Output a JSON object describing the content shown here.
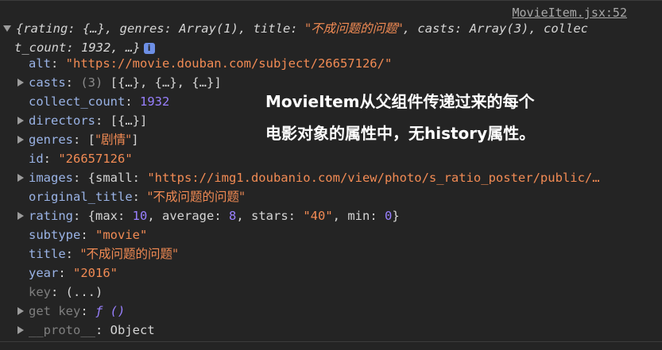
{
  "source_link": "MovieItem.jsx:52",
  "summary": {
    "line1_a": "{rating: {…}, genres: Array(1), title: ",
    "line1_title": "\"不成问题的问题\"",
    "line1_b": ", casts: Array(3), collec",
    "line2": "t_count: 1932, …}",
    "info_badge": "i"
  },
  "properties": [
    {
      "key": "alt",
      "sep": ": ",
      "value": "\"https://movie.douban.com/subject/26657126/\"",
      "value_type": "str",
      "expandable": false
    },
    {
      "key": "casts",
      "sep": ": ",
      "prefix": "(3) ",
      "value": "[{…}, {…}, {…}]",
      "value_type": "plain",
      "expandable": true
    },
    {
      "key": "collect_count",
      "sep": ": ",
      "value": "1932",
      "value_type": "num",
      "expandable": false
    },
    {
      "key": "directors",
      "sep": ": ",
      "value": "[{…}]",
      "value_type": "plain",
      "expandable": true
    },
    {
      "key": "genres",
      "sep": ": ",
      "value_open": "[",
      "value": "\"剧情\"",
      "value_close": "]",
      "value_type": "str",
      "expandable": true
    },
    {
      "key": "id",
      "sep": ": ",
      "value": "\"26657126\"",
      "value_type": "str",
      "expandable": false
    },
    {
      "key": "images",
      "sep": ": ",
      "value_open": "{small: ",
      "value": "\"https://img1.doubanio.com/view/photo/s_ratio_poster/public/…",
      "value_type": "str",
      "expandable": true
    },
    {
      "key": "original_title",
      "sep": ": ",
      "value": "\"不成问题的问题\"",
      "value_type": "str",
      "expandable": false
    },
    {
      "key": "rating",
      "sep": ": ",
      "expandable": true,
      "rating_parts": {
        "open": "{max: ",
        "max": "10",
        "sep1": ", average: ",
        "average": "8",
        "sep2": ", stars: ",
        "stars": "\"40\"",
        "sep3": ", min: ",
        "min": "0",
        "close": "}"
      }
    },
    {
      "key": "subtype",
      "sep": ": ",
      "value": "\"movie\"",
      "value_type": "str",
      "expandable": false
    },
    {
      "key": "title",
      "sep": ": ",
      "value": "\"不成问题的问题\"",
      "value_type": "str",
      "expandable": false
    },
    {
      "key": "year",
      "sep": ": ",
      "value": "\"2016\"",
      "value_type": "str",
      "expandable": false
    },
    {
      "key": "key",
      "sep": ": ",
      "value": "(...)",
      "value_type": "plain",
      "expandable": false,
      "dim_key": true
    },
    {
      "key": "get key",
      "sep": ": ",
      "value": "ƒ ()",
      "value_type": "fn",
      "expandable": true,
      "dim_key": true
    },
    {
      "key": "__proto__",
      "sep": ": ",
      "value": "Object",
      "value_type": "plain",
      "expandable": true,
      "dim_key": true
    }
  ],
  "annotation": {
    "line1": "MovieItem从父组件传递过来的每个",
    "line2": "电影对象的属性中，无history属性。"
  }
}
